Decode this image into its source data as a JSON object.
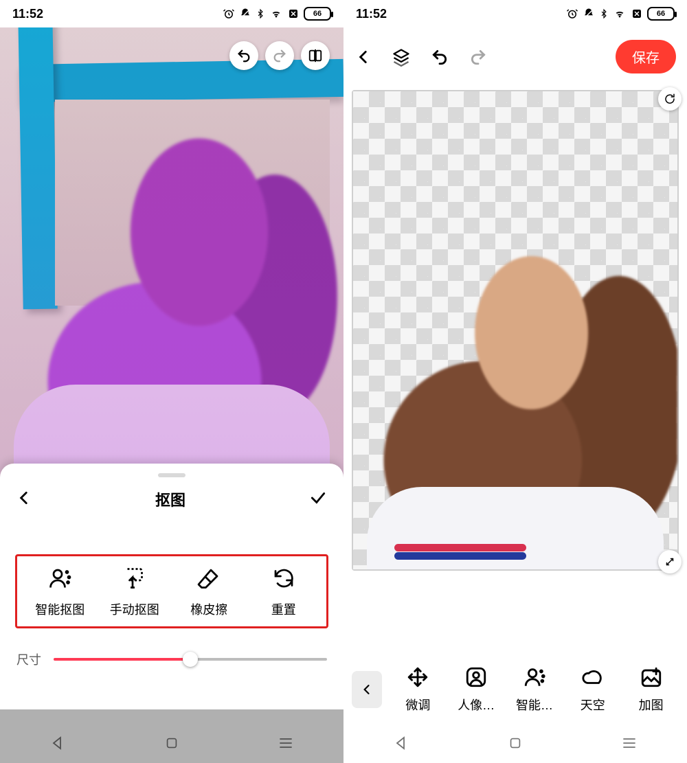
{
  "status": {
    "time": "11:52",
    "battery": "66"
  },
  "left": {
    "sheet_title": "抠图",
    "tools": [
      {
        "id": "smart-cutout",
        "label": "智能抠图"
      },
      {
        "id": "manual-cutout",
        "label": "手动抠图"
      },
      {
        "id": "eraser",
        "label": "橡皮擦"
      },
      {
        "id": "reset",
        "label": "重置"
      }
    ],
    "slider": {
      "label": "尺寸",
      "value_pct": 50
    }
  },
  "right": {
    "save_label": "保存",
    "redo_disabled": true,
    "tools": [
      {
        "id": "fine-tune",
        "label": "微调"
      },
      {
        "id": "portrait",
        "label": "人像…"
      },
      {
        "id": "smart",
        "label": "智能…"
      },
      {
        "id": "sky",
        "label": "天空"
      },
      {
        "id": "add-image",
        "label": "加图"
      }
    ]
  }
}
